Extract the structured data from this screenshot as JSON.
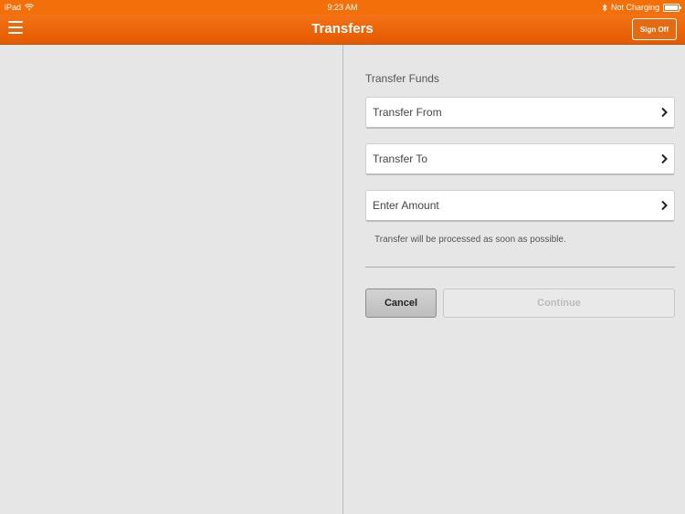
{
  "status_bar": {
    "device": "iPad",
    "time": "9:23 AM",
    "charging": "Not Charging"
  },
  "nav": {
    "title": "Transfers",
    "sign_off": "Sign Off"
  },
  "transfer": {
    "section_title": "Transfer Funds",
    "rows": [
      {
        "label": "Transfer From"
      },
      {
        "label": "Transfer To"
      },
      {
        "label": "Enter Amount"
      }
    ],
    "note": "Transfer will be processed as soon as possible.",
    "cancel_label": "Cancel",
    "continue_label": "Continue"
  },
  "colors": {
    "brand_orange": "#f26f0a"
  }
}
